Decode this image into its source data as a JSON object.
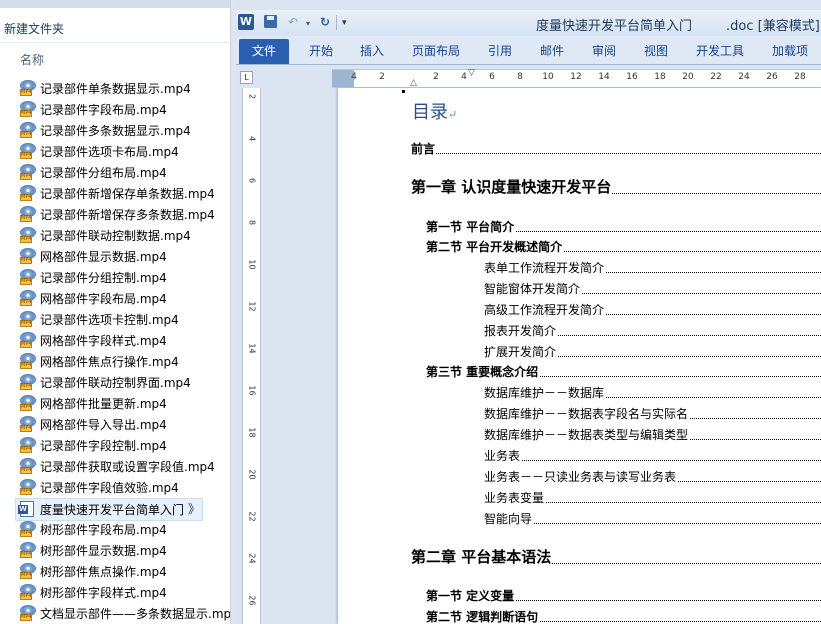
{
  "explorer": {
    "folder_title": "新建文件夹",
    "column_name": "名称",
    "files": [
      {
        "name": "记录部件单条数据显示.mp4",
        "icon": "mp4-file-icon"
      },
      {
        "name": "记录部件字段布局.mp4",
        "icon": "mp4-file-icon"
      },
      {
        "name": "记录部件多条数据显示.mp4",
        "icon": "mp4-file-icon"
      },
      {
        "name": "记录部件选项卡布局.mp4",
        "icon": "mp4-file-icon"
      },
      {
        "name": "记录部件分组布局.mp4",
        "icon": "mp4-file-icon"
      },
      {
        "name": "记录部件新增保存单条数据.mp4",
        "icon": "mp4-file-icon"
      },
      {
        "name": "记录部件新增保存多条数据.mp4",
        "icon": "mp4-file-icon"
      },
      {
        "name": "记录部件联动控制数据.mp4",
        "icon": "mp4-file-icon"
      },
      {
        "name": "网格部件显示数据.mp4",
        "icon": "mp4-file-icon"
      },
      {
        "name": "记录部件分组控制.mp4",
        "icon": "mp4-file-icon"
      },
      {
        "name": "网格部件字段布局.mp4",
        "icon": "mp4-file-icon"
      },
      {
        "name": "记录部件选项卡控制.mp4",
        "icon": "mp4-file-icon"
      },
      {
        "name": "网格部件字段样式.mp4",
        "icon": "mp4-file-icon"
      },
      {
        "name": "网格部件焦点行操作.mp4",
        "icon": "mp4-file-icon"
      },
      {
        "name": "记录部件联动控制界面.mp4",
        "icon": "mp4-file-icon"
      },
      {
        "name": "网格部件批量更新.mp4",
        "icon": "mp4-file-icon"
      },
      {
        "name": "网格部件导入导出.mp4",
        "icon": "mp4-file-icon"
      },
      {
        "name": "记录部件字段控制.mp4",
        "icon": "mp4-file-icon"
      },
      {
        "name": "记录部件获取或设置字段值.mp4",
        "icon": "mp4-file-icon"
      },
      {
        "name": "记录部件字段值效验.mp4",
        "icon": "mp4-file-icon"
      },
      {
        "name": "度量快速开发平台简单入门",
        "icon": "word-doc-icon",
        "selected": true,
        "more": "》"
      },
      {
        "name": "树形部件字段布局.mp4",
        "icon": "mp4-file-icon"
      },
      {
        "name": "树形部件显示数据.mp4",
        "icon": "mp4-file-icon"
      },
      {
        "name": "树形部件焦点操作.mp4",
        "icon": "mp4-file-icon"
      },
      {
        "name": "树形部件字段样式.mp4",
        "icon": "mp4-file-icon"
      },
      {
        "name": "文档显示部件——多条数据显示.mp",
        "icon": "mp4-file-icon"
      }
    ]
  },
  "word": {
    "title": "度量快速开发平台简单入门",
    "title_suffix": ".doc [兼容模式] -",
    "app_icon_letter": "W",
    "tabs": [
      "文件",
      "开始",
      "插入",
      "页面布局",
      "引用",
      "邮件",
      "审阅",
      "视图",
      "开发工具",
      "加载项"
    ],
    "ruler_corner": "L",
    "hruler_ticks": [
      "4",
      "2",
      "2",
      "4",
      "6",
      "8",
      "10",
      "12",
      "14",
      "16",
      "18",
      "20",
      "22",
      "24",
      "26",
      "28"
    ],
    "vruler_ticks": [
      "2",
      "4",
      "6",
      "8",
      "10",
      "12",
      "14",
      "16",
      "18",
      "20",
      "22",
      "24",
      "26"
    ]
  },
  "document": {
    "toc_heading": "目录",
    "toc_heading_mark": "↵",
    "entries": [
      {
        "level": 0,
        "text": "前言"
      },
      {
        "level": 1,
        "text": "第一章  认识度量快速开发平台"
      },
      {
        "level": 2,
        "text": "第一节  平台简介"
      },
      {
        "level": 2,
        "text": "第二节  平台开发概述简介"
      },
      {
        "level": 3,
        "text": "表单工作流程开发简介"
      },
      {
        "level": 3,
        "text": "智能窗体开发简介"
      },
      {
        "level": 3,
        "text": "高级工作流程开发简介"
      },
      {
        "level": 3,
        "text": "报表开发简介"
      },
      {
        "level": 3,
        "text": "扩展开发简介"
      },
      {
        "level": 2,
        "text": "第三节  重要概念介绍"
      },
      {
        "level": 3,
        "text": "数据库维护－－数据库"
      },
      {
        "level": 3,
        "text": "数据库维护－－数据表字段名与实际名"
      },
      {
        "level": 3,
        "text": "数据库维护－－数据表类型与编辑类型"
      },
      {
        "level": 3,
        "text": "业务表"
      },
      {
        "level": 3,
        "text": "业务表－－只读业务表与读写业务表"
      },
      {
        "level": 3,
        "text": "业务表变量"
      },
      {
        "level": 3,
        "text": "智能向导"
      },
      {
        "level": 1,
        "text": "第二章  平台基本语法"
      },
      {
        "level": 2,
        "text": "第一节  定义变量"
      },
      {
        "level": 2,
        "text": "第二节  逻辑判断语句"
      }
    ]
  }
}
